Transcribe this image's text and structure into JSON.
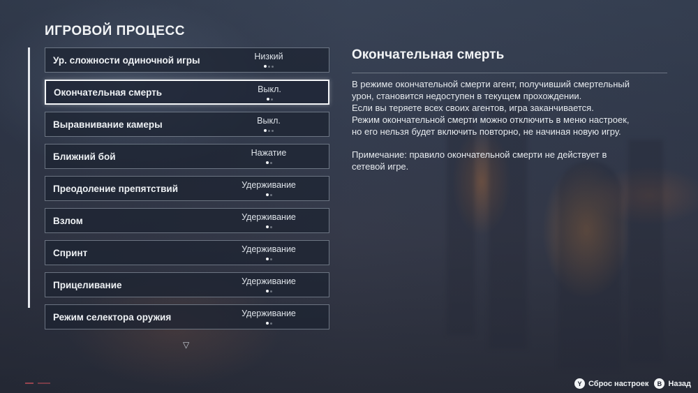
{
  "page": {
    "title": "ИГРОВОЙ ПРОЦЕСС"
  },
  "settings": [
    {
      "label": "Ур. сложности одиночной игры",
      "value": "Низкий",
      "option_count": 3,
      "selected_index": 0,
      "selected": false
    },
    {
      "label": "Окончательная смерть",
      "value": "Выкл.",
      "option_count": 2,
      "selected_index": 0,
      "selected": true
    },
    {
      "label": "Выравнивание камеры",
      "value": "Выкл.",
      "option_count": 3,
      "selected_index": 0,
      "selected": false
    },
    {
      "label": "Ближний бой",
      "value": "Нажатие",
      "option_count": 2,
      "selected_index": 0,
      "selected": false
    },
    {
      "label": "Преодоление препятствий",
      "value": "Удерживание",
      "option_count": 2,
      "selected_index": 0,
      "selected": false
    },
    {
      "label": "Взлом",
      "value": "Удерживание",
      "option_count": 2,
      "selected_index": 0,
      "selected": false
    },
    {
      "label": "Спринт",
      "value": "Удерживание",
      "option_count": 2,
      "selected_index": 0,
      "selected": false
    },
    {
      "label": "Прицеливание",
      "value": "Удерживание",
      "option_count": 2,
      "selected_index": 0,
      "selected": false
    },
    {
      "label": "Режим селектора оружия",
      "value": "Удерживание",
      "option_count": 2,
      "selected_index": 0,
      "selected": false
    }
  ],
  "list_more": {
    "icon": "triangle-down-icon",
    "glyph": "▽"
  },
  "detail": {
    "title": "Окончательная смерть",
    "paragraph1": "В режиме окончательной смерти агент, получивший смертельный\nурон, становится недоступен в текущем прохождении.\nЕсли вы теряете всех своих агентов, игра заканчивается.\nРежим окончательной смерти можно отключить в меню настроек,\nно его нельзя будет включить повторно, не начиная новую игру.",
    "paragraph2": "Примечание: правило окончательной смерти не действует в\nсетевой игре."
  },
  "hints": {
    "reset": {
      "button": "Y",
      "label": "Сброс настроек"
    },
    "back": {
      "button": "B",
      "label": "Назад"
    }
  },
  "colors": {
    "selected_border": "#f4f6f8",
    "row_border": "#c8d2e1"
  }
}
